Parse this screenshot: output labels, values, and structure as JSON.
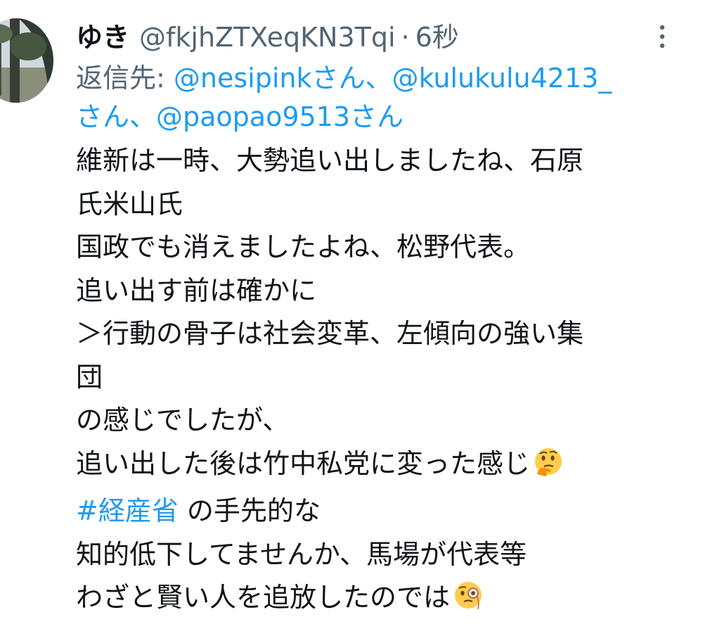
{
  "tweet": {
    "author": {
      "name": "ゆき",
      "handle": "@fkjhZTXeqKN3Tqi",
      "separator": "·",
      "time": "6秒"
    },
    "more_icon": "more-vertical-icon",
    "reply": {
      "prefix": "返信先: ",
      "mention1": "@nesipinkさん、",
      "mention2": "@kulukulu4213_",
      "mention2_suffix": "さん、",
      "mention3": "@paopao9513さん"
    },
    "body": {
      "line1": "維新は一時、大勢追い出しましたね、石原",
      "line2": "氏米山氏",
      "line3": "国政でも消えましたよね、松野代表。",
      "line4": "追い出す前は確かに",
      "line5": "＞行動の骨子は社会変革、左傾向の強い集",
      "line6": "団",
      "line7": "の感じでしたが、",
      "line8": "追い出した後は竹中私党に変った感じ",
      "line8_emoji": "thinking-face",
      "line9_hashtag": "#経産省",
      "line9_rest": " の手先的な",
      "line10": "知的低下してませんか、馬場が代表等",
      "line11": "わざと賢い人を追放したのでは",
      "line11_emoji": "face-with-monocle"
    },
    "colors": {
      "text": "#0f1419",
      "secondary": "#536471",
      "link": "#1d9bf0"
    }
  }
}
